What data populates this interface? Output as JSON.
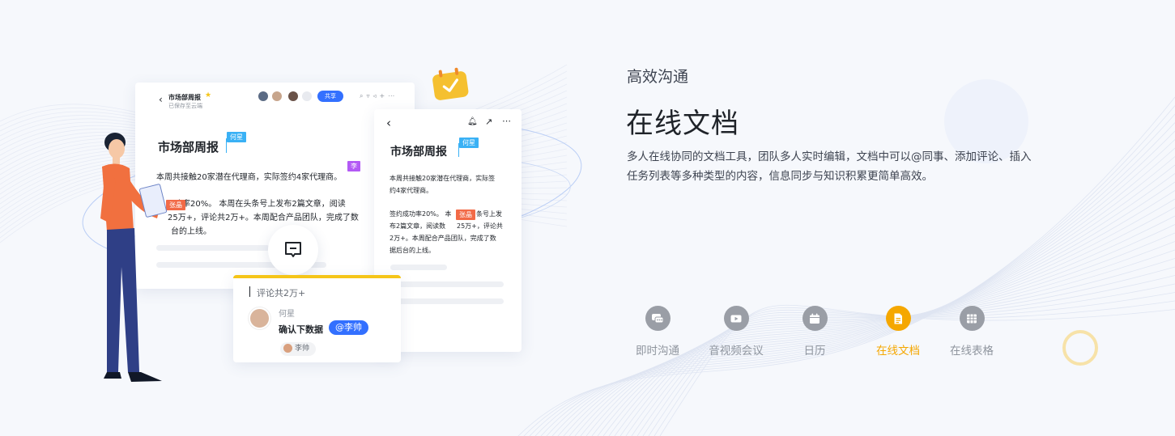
{
  "section": {
    "subtitle": "高效沟通",
    "title": "在线文档",
    "description": "多人在线协同的文档工具，团队多人实时编辑，文档中可以@同事、添加评论、插入任务列表等多种类型的内容，信息同步与知识积累更简单高效。"
  },
  "tabs": [
    {
      "label": "即时沟通",
      "icon": "chat-icon",
      "active": false
    },
    {
      "label": "音视频会议",
      "icon": "video-icon",
      "active": false
    },
    {
      "label": "日历",
      "icon": "calendar-icon",
      "active": false
    },
    {
      "label": "在线文档",
      "icon": "document-icon",
      "active": true
    },
    {
      "label": "在线表格",
      "icon": "table-icon",
      "active": false
    }
  ],
  "doc_main": {
    "header_title": "市场部周报",
    "header_status": "已保存至云端",
    "share_label": "共享",
    "heading": "市场部周报",
    "line1": "本周共接触20家潜在代理商，实际签约4家代理商。",
    "line2a": "签约成功率20%。 本周在头条号上发布2篇文章，阅读",
    "line2b": "数25万+，评论共2万+。本周配合产品团队，完成了数",
    "line2c": "据后台的上线。",
    "frag2a": "功率20%。 本周在头条号上发布2篇文章，阅读",
    "frag2b": "25万+，评论共2万+。本周配合产品团队，完成了数",
    "frag2c": "台的上线。",
    "tag_he": "何星",
    "tag_li": "李",
    "tag_zhang": "张晶"
  },
  "doc_phone": {
    "heading": "市场部周报",
    "tag_he": "何星",
    "tag_zhang": "张晶",
    "p1": "本周共接触20家潜在代理商，实际签",
    "p2": "约4家代理商。",
    "p3": "签约成功率20%。 本",
    "p3b": "条号上发",
    "p4": "布2篇文章，阅读数",
    "p4b": "25万+，评论共",
    "p5": "2万+。本周配合产品团队，完成了数",
    "p6": "据后台的上线。"
  },
  "comment": {
    "input_text": "评论共2万+",
    "author": "何星",
    "message": "确认下数据",
    "mention": "@李帅",
    "reply_user": "李帅"
  },
  "colors": {
    "accent": "#f5a700",
    "primary_blue": "#3370ff",
    "tab_gray": "#9a9ea6"
  }
}
